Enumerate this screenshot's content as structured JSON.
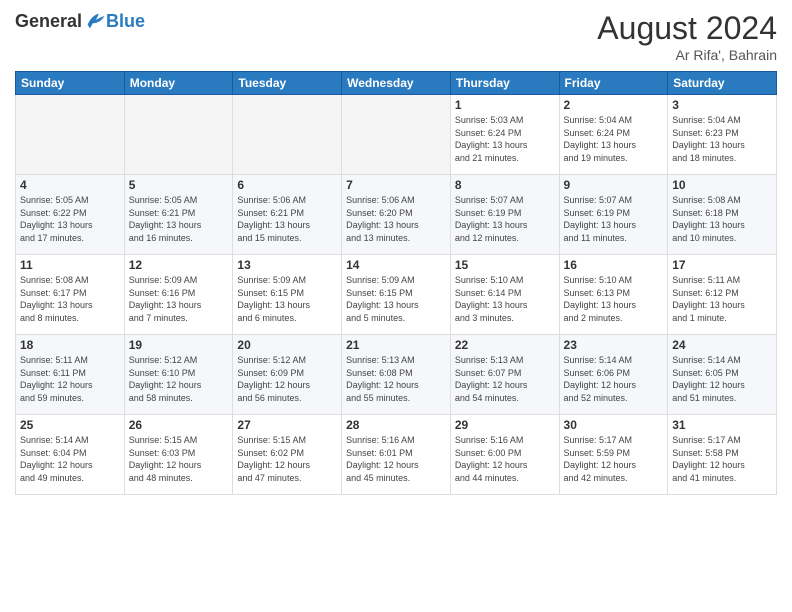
{
  "logo": {
    "general": "General",
    "blue": "Blue"
  },
  "header": {
    "month_year": "August 2024",
    "location": "Ar Rifa', Bahrain"
  },
  "days_of_week": [
    "Sunday",
    "Monday",
    "Tuesday",
    "Wednesday",
    "Thursday",
    "Friday",
    "Saturday"
  ],
  "weeks": [
    [
      {
        "day": "",
        "info": ""
      },
      {
        "day": "",
        "info": ""
      },
      {
        "day": "",
        "info": ""
      },
      {
        "day": "",
        "info": ""
      },
      {
        "day": "1",
        "info": "Sunrise: 5:03 AM\nSunset: 6:24 PM\nDaylight: 13 hours\nand 21 minutes."
      },
      {
        "day": "2",
        "info": "Sunrise: 5:04 AM\nSunset: 6:24 PM\nDaylight: 13 hours\nand 19 minutes."
      },
      {
        "day": "3",
        "info": "Sunrise: 5:04 AM\nSunset: 6:23 PM\nDaylight: 13 hours\nand 18 minutes."
      }
    ],
    [
      {
        "day": "4",
        "info": "Sunrise: 5:05 AM\nSunset: 6:22 PM\nDaylight: 13 hours\nand 17 minutes."
      },
      {
        "day": "5",
        "info": "Sunrise: 5:05 AM\nSunset: 6:21 PM\nDaylight: 13 hours\nand 16 minutes."
      },
      {
        "day": "6",
        "info": "Sunrise: 5:06 AM\nSunset: 6:21 PM\nDaylight: 13 hours\nand 15 minutes."
      },
      {
        "day": "7",
        "info": "Sunrise: 5:06 AM\nSunset: 6:20 PM\nDaylight: 13 hours\nand 13 minutes."
      },
      {
        "day": "8",
        "info": "Sunrise: 5:07 AM\nSunset: 6:19 PM\nDaylight: 13 hours\nand 12 minutes."
      },
      {
        "day": "9",
        "info": "Sunrise: 5:07 AM\nSunset: 6:19 PM\nDaylight: 13 hours\nand 11 minutes."
      },
      {
        "day": "10",
        "info": "Sunrise: 5:08 AM\nSunset: 6:18 PM\nDaylight: 13 hours\nand 10 minutes."
      }
    ],
    [
      {
        "day": "11",
        "info": "Sunrise: 5:08 AM\nSunset: 6:17 PM\nDaylight: 13 hours\nand 8 minutes."
      },
      {
        "day": "12",
        "info": "Sunrise: 5:09 AM\nSunset: 6:16 PM\nDaylight: 13 hours\nand 7 minutes."
      },
      {
        "day": "13",
        "info": "Sunrise: 5:09 AM\nSunset: 6:15 PM\nDaylight: 13 hours\nand 6 minutes."
      },
      {
        "day": "14",
        "info": "Sunrise: 5:09 AM\nSunset: 6:15 PM\nDaylight: 13 hours\nand 5 minutes."
      },
      {
        "day": "15",
        "info": "Sunrise: 5:10 AM\nSunset: 6:14 PM\nDaylight: 13 hours\nand 3 minutes."
      },
      {
        "day": "16",
        "info": "Sunrise: 5:10 AM\nSunset: 6:13 PM\nDaylight: 13 hours\nand 2 minutes."
      },
      {
        "day": "17",
        "info": "Sunrise: 5:11 AM\nSunset: 6:12 PM\nDaylight: 13 hours\nand 1 minute."
      }
    ],
    [
      {
        "day": "18",
        "info": "Sunrise: 5:11 AM\nSunset: 6:11 PM\nDaylight: 12 hours\nand 59 minutes."
      },
      {
        "day": "19",
        "info": "Sunrise: 5:12 AM\nSunset: 6:10 PM\nDaylight: 12 hours\nand 58 minutes."
      },
      {
        "day": "20",
        "info": "Sunrise: 5:12 AM\nSunset: 6:09 PM\nDaylight: 12 hours\nand 56 minutes."
      },
      {
        "day": "21",
        "info": "Sunrise: 5:13 AM\nSunset: 6:08 PM\nDaylight: 12 hours\nand 55 minutes."
      },
      {
        "day": "22",
        "info": "Sunrise: 5:13 AM\nSunset: 6:07 PM\nDaylight: 12 hours\nand 54 minutes."
      },
      {
        "day": "23",
        "info": "Sunrise: 5:14 AM\nSunset: 6:06 PM\nDaylight: 12 hours\nand 52 minutes."
      },
      {
        "day": "24",
        "info": "Sunrise: 5:14 AM\nSunset: 6:05 PM\nDaylight: 12 hours\nand 51 minutes."
      }
    ],
    [
      {
        "day": "25",
        "info": "Sunrise: 5:14 AM\nSunset: 6:04 PM\nDaylight: 12 hours\nand 49 minutes."
      },
      {
        "day": "26",
        "info": "Sunrise: 5:15 AM\nSunset: 6:03 PM\nDaylight: 12 hours\nand 48 minutes."
      },
      {
        "day": "27",
        "info": "Sunrise: 5:15 AM\nSunset: 6:02 PM\nDaylight: 12 hours\nand 47 minutes."
      },
      {
        "day": "28",
        "info": "Sunrise: 5:16 AM\nSunset: 6:01 PM\nDaylight: 12 hours\nand 45 minutes."
      },
      {
        "day": "29",
        "info": "Sunrise: 5:16 AM\nSunset: 6:00 PM\nDaylight: 12 hours\nand 44 minutes."
      },
      {
        "day": "30",
        "info": "Sunrise: 5:17 AM\nSunset: 5:59 PM\nDaylight: 12 hours\nand 42 minutes."
      },
      {
        "day": "31",
        "info": "Sunrise: 5:17 AM\nSunset: 5:58 PM\nDaylight: 12 hours\nand 41 minutes."
      }
    ]
  ]
}
